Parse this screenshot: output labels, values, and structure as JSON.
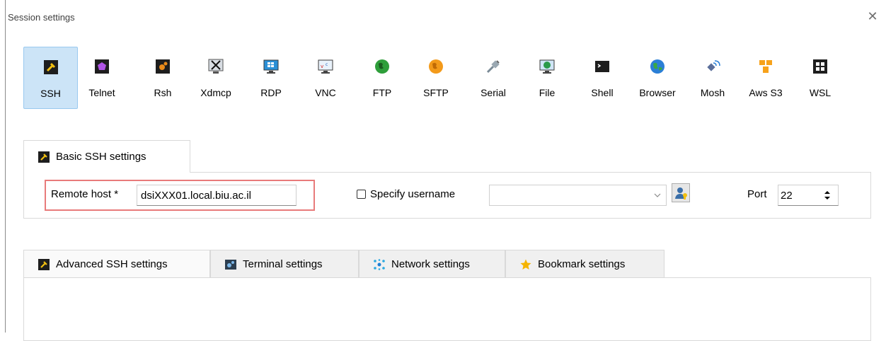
{
  "window": {
    "title": "Session settings",
    "close_icon": "close-icon"
  },
  "session_types": [
    {
      "label": "SSH",
      "icon": "ssh-key-icon",
      "selected": true
    },
    {
      "label": "Telnet",
      "icon": "telnet-icon"
    },
    {
      "label": "Rsh",
      "icon": "rsh-icon"
    },
    {
      "label": "Xdmcp",
      "icon": "xdmcp-icon"
    },
    {
      "label": "RDP",
      "icon": "rdp-monitor-icon"
    },
    {
      "label": "VNC",
      "icon": "vnc-icon"
    },
    {
      "label": "FTP",
      "icon": "ftp-globe-icon"
    },
    {
      "label": "SFTP",
      "icon": "sftp-globe-icon"
    },
    {
      "label": "Serial",
      "icon": "serial-plug-icon"
    },
    {
      "label": "File",
      "icon": "file-globe-icon"
    },
    {
      "label": "Shell",
      "icon": "shell-terminal-icon"
    },
    {
      "label": "Browser",
      "icon": "browser-globe-icon"
    },
    {
      "label": "Mosh",
      "icon": "mosh-satellite-icon"
    },
    {
      "label": "Aws S3",
      "icon": "aws-s3-icon"
    },
    {
      "label": "WSL",
      "icon": "wsl-windows-icon"
    }
  ],
  "basic": {
    "tab_label": "Basic SSH settings",
    "remote_host_label": "Remote host *",
    "remote_host_value": "dsiXXX01.local.biu.ac.il",
    "specify_username_label": "Specify username",
    "username_value": "",
    "port_label": "Port",
    "port_value": "22"
  },
  "tabs": [
    {
      "label": "Advanced SSH settings",
      "icon": "wrench-key-icon"
    },
    {
      "label": "Terminal settings",
      "icon": "terminal-settings-icon"
    },
    {
      "label": "Network settings",
      "icon": "network-icon"
    },
    {
      "label": "Bookmark settings",
      "icon": "star-icon"
    }
  ],
  "colors": {
    "selected_bg": "#cce4f7",
    "highlight_border": "#e87b7b"
  }
}
